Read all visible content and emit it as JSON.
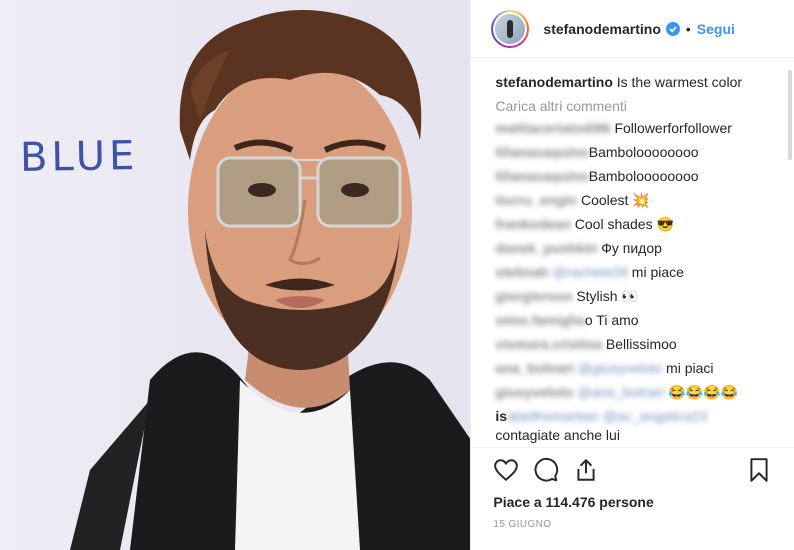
{
  "post": {
    "image_text": "BLUE",
    "author": "stefanodemartino",
    "separator": "•",
    "follow_label": "Segui",
    "caption_text": "Is the warmest color",
    "load_more_label": "Carica altri commenti",
    "comments": [
      {
        "user": "mattiaceriatodi96",
        "mention": "",
        "text": "Followerforfollower"
      },
      {
        "user": "lilianasaquino",
        "mention": "",
        "text": "Bamboloooooooo"
      },
      {
        "user": "lilianasaquino",
        "mention": "",
        "text": "Bamboloooooooo"
      },
      {
        "user": "tiurru_engin",
        "mention": "",
        "text": "Coolest 💥"
      },
      {
        "user": "frankodean",
        "mention": "",
        "text": "Cool shades 😎"
      },
      {
        "user": "danek_pushkin",
        "mention": "",
        "text": "Фу пидор"
      },
      {
        "user": "stelinah",
        "mention": "@rachele09",
        "text": "mi piace"
      },
      {
        "user": "giorgieroos",
        "mention": "",
        "text": "Stylish 👀"
      },
      {
        "user": "simo.famiglia",
        "mention": "",
        "text": "o Ti amo"
      },
      {
        "user": "vismara.cristina",
        "mention": "",
        "text": "Bellissimoo"
      },
      {
        "user": "ana_bolnari",
        "mention": "@giusyveloto",
        "text": "mi piaci"
      },
      {
        "user": "giusyveloto",
        "mention": "@ana_bolnari",
        "text": "😂😂😂😂"
      },
      {
        "user": "is",
        "mention": "abellhemartian @ac_angelica23",
        "text": ""
      }
    ],
    "last_comment_tail": "contagiate anche lui",
    "likes_text": "Piace a 114.476 persone",
    "date_text": "15 giugno",
    "icons": [
      "heart-icon",
      "comment-icon",
      "share-icon",
      "bookmark-icon",
      "verified-badge-icon"
    ],
    "colors": {
      "link": "#3897f0",
      "text": "#262626",
      "muted": "#999999",
      "wall_text": "#3c53a8"
    }
  }
}
